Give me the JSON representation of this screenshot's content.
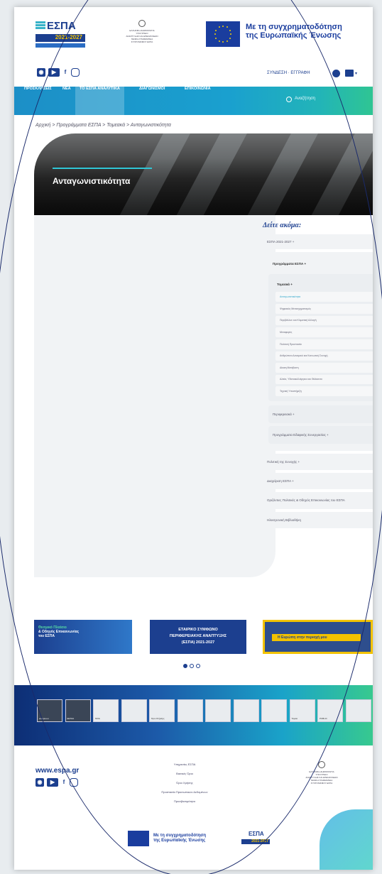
{
  "header": {
    "logo_text": "ΕΣΠΑ",
    "logo_years": "2021-2027",
    "ministry_lines": [
      "ΕΛΛΗΝΙΚΗ ΔΗΜΟΚΡΑΤΙΑ",
      "ΥΠΟΥΡΓΕΙΟ",
      "ΑΝΑΠΤΥΞΗΣ ΚΑΙ ΕΠΕΝΔΥΣΕΩΝ",
      "ΓΕΝΙΚΗ ΓΡΑΜΜΑΤΕΙΑ",
      "ΣΥΝΤΟΝΙΣΜΟΥ ΕΣΠΑ"
    ],
    "cofund_line1": "Με τη συγχρηματοδότηση",
    "cofund_line2": "της Ευρωπαϊκής Ένωσης"
  },
  "topbar": {
    "login": "ΣΥΝΔΕΣΗ · ΕΓΓΡΑΦΗ",
    "social_icons": [
      "rss-icon",
      "youtube-icon",
      "facebook-icon",
      "instagram-icon"
    ]
  },
  "nav": {
    "items": [
      "ΠΡΟΣΚΛΗΣΕΙΣ",
      "ΝΕΑ",
      "ΤΟ ΕΣΠΑ ΑΝΑΛΥΤΙΚΑ",
      "ΔΙΑΓΩΝΙΣΜΟΙ",
      "ΕΠΙΚΟΙΝΩΝΙΑ"
    ],
    "active_index": 2,
    "search_placeholder": "Αναζήτηση"
  },
  "breadcrumb": "Αρχική > Προγράμματα ΕΣΠΑ > Τομεακά > Ανταγωνιστικότητα",
  "hero": {
    "title": "Ανταγωνιστικότητα"
  },
  "sidebar": {
    "heading": "Δείτε ακόμα:",
    "top": "ΕΣΠΑ 2021-2027 +",
    "programs": "Προγράμματα ΕΣΠΑ +",
    "sectoral": "Τομεακά +",
    "leaves": [
      "Ανταγωνιστικότητα",
      "Ψηφιακός Μετασχηματισμός",
      "Περιβάλλον και Κλιματική Αλλαγή",
      "Μεταφορές",
      "Πολιτική Προστασία",
      "Ανθρώπινο Δυναμικό και Κοινωνική Συνοχή",
      "Δίκαιη Μετάβαση",
      "Αλιεία, Υδατοκαλλιέργεια και Θάλασσα",
      "Τεχνική Υποστήριξη"
    ],
    "leaf_active_index": 0,
    "regional": "Περιφερειακά +",
    "territorial": "Προγράμματα Εδαφικής Συνεργασίας +",
    "rest": [
      "Πολιτική της Συνοχής +",
      "Διαχείριση ΕΣΠΑ +",
      "Οριζόντιες Πολιτικές & Οδηγός Επικοινωνίας του ΕΣΠΑ",
      "Ηλεκτρονική Βιβλιοθήκη"
    ]
  },
  "banners": {
    "b1_line1": "Θεσμικό Πλαίσιο",
    "b1_line2": "& Οδηγός Επικοινωνίας",
    "b1_line3": "του ΕΣΠΑ",
    "b2_line1": "ΕΤΑΙΡΙΚΟ ΣΥΜΦΩΝΟ",
    "b2_line2": "ΠΕΡΙΦΕΡΕΙΑΚΗΣ ΑΝΑΠΤΥΞΗΣ",
    "b2_line3": "(ΕΣΠΑ) 2021-2027",
    "b3_text": "Η Ευρώπη στην περιοχή μου"
  },
  "partners": [
    "europa.eu",
    "ΕΕΤΑΑ",
    "ΜΟΔ",
    "",
    "Όροι Στήριξης",
    "",
    "",
    "",
    "",
    "Ταμείο",
    "PUBLIC",
    ""
  ],
  "footer": {
    "site": "www.espa.gr",
    "links": [
      "Υπηρεσίες ΕΣΠΑ",
      "Βασικές Όροι",
      "Όροι Χρήσης",
      "Προστασία Προσωπικών Δεδομένων",
      "Προσβασιμότητα"
    ],
    "cofund_line1": "Με τη συγχρηματοδότηση",
    "cofund_line2": "της Ευρωπαϊκής Ένωσης",
    "mini_logo": "ΕΣΠΑ",
    "mini_years": "2021-2027"
  },
  "colors": {
    "brand": "#1c3f8f",
    "accent": "#2aa4c8",
    "gold": "#f2c200"
  }
}
